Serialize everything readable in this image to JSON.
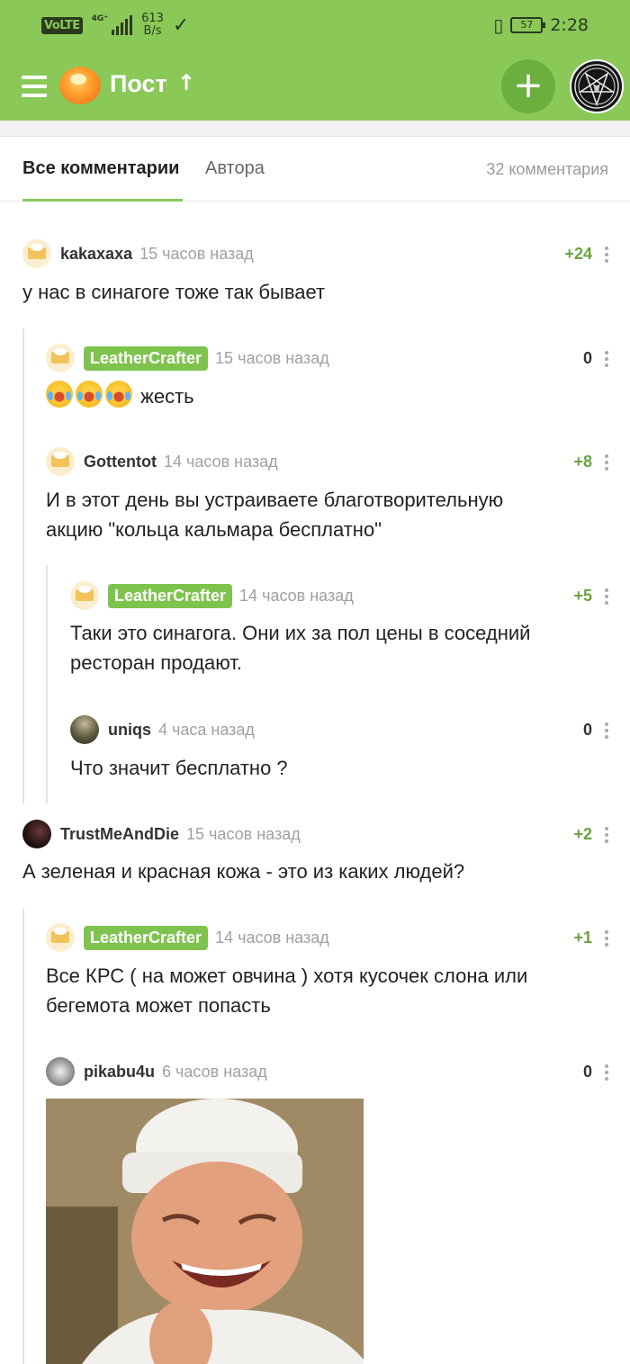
{
  "status_bar": {
    "volte": "VoLTE",
    "network": "4G⁺",
    "net_speed_value": "613",
    "net_speed_unit": "B/s",
    "battery": "57",
    "time": "2:28"
  },
  "topbar": {
    "title": "Пост"
  },
  "tabs": {
    "all": "Все комментарии",
    "author": "Автора",
    "count": "32 комментария"
  },
  "comments": [
    {
      "user": "kakaxaxa",
      "time": "15 часов назад",
      "score": "+24",
      "text": "у нас в синагоге тоже так бывает"
    },
    {
      "user": "LeatherCrafter",
      "time": "15 часов назад",
      "score": "0",
      "text": "жесть"
    },
    {
      "user": "Gottentot",
      "time": "14 часов назад",
      "score": "+8",
      "text_lines": [
        "И в этот день вы устраиваете благотворительную",
        "акцию \"кольца кальмара бесплатно\""
      ]
    },
    {
      "user": "LeatherCrafter",
      "time": "14 часов назад",
      "score": "+5",
      "text_lines": [
        "Таки это синагога. Они их за пол цены в соседний",
        "ресторан продают."
      ]
    },
    {
      "user": "uniqs",
      "time": "4 часа назад",
      "score": "0",
      "text": "Что значит бесплатно ?"
    },
    {
      "user": "TrustMeAndDie",
      "time": "15 часов назад",
      "score": "+2",
      "text": "А зеленая и красная кожа - это из каких людей?"
    },
    {
      "user": "LeatherCrafter",
      "time": "14 часов назад",
      "score": "+1",
      "text_lines": [
        "Все КРС ( на может овчина ) хотя кусочек слона или",
        "бегемота может попасть"
      ]
    },
    {
      "user": "pikabu4u",
      "time": "6 часов назад",
      "score": "0"
    }
  ],
  "colors": {
    "accent": "#8ac858",
    "badge": "#7ec34d",
    "positive": "#6aa33d"
  },
  "icons": [
    "menu-icon",
    "pikabu-logo",
    "arrow-up-icon",
    "plus-icon",
    "vibrate-icon",
    "battery-icon",
    "check-icon",
    "more-vertical-icon",
    "laughing-emoji"
  ]
}
